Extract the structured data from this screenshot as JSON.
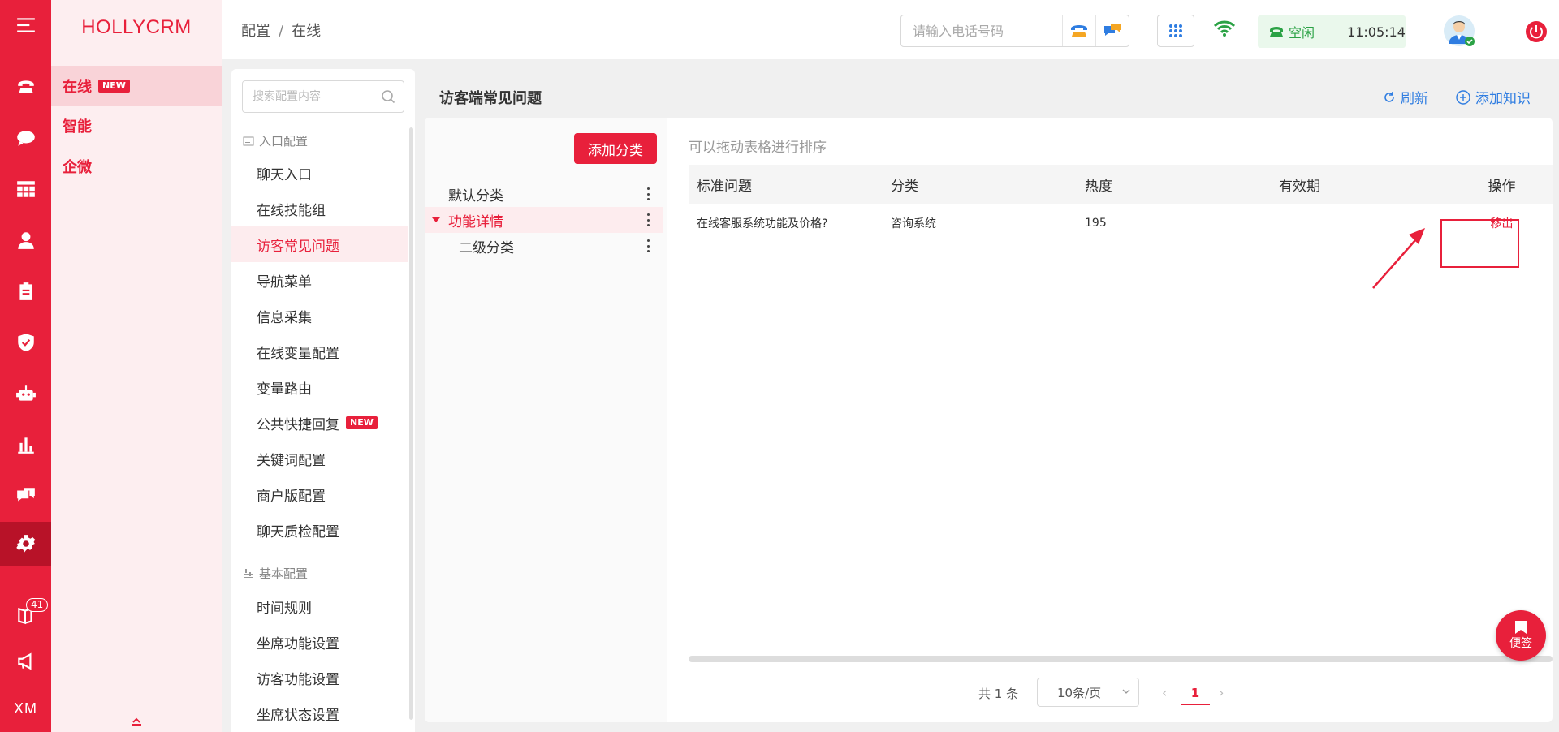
{
  "rail": {
    "badge_count": "41",
    "footer_text": "XM",
    "icons": [
      "menu-icon",
      "phone-icon",
      "chat-icon",
      "grid-icon",
      "user-icon",
      "clipboard-icon",
      "shield-icon",
      "robot-icon",
      "stats-icon",
      "message-icon",
      "settings-icon",
      "book-icon",
      "megaphone-icon"
    ]
  },
  "menu2": {
    "brand": "HOLLYCRM",
    "new_tag": "NEW",
    "items": [
      {
        "label": "在线"
      },
      {
        "label": "智能"
      },
      {
        "label": "企微"
      }
    ]
  },
  "header": {
    "breadcrumb": [
      "配置",
      "在线"
    ],
    "breadcrumb_sep": "/",
    "phone_placeholder": "请输入电话号码",
    "status_label": "空闲",
    "time": "11:05:14"
  },
  "config_nav": {
    "search_placeholder": "搜索配置内容",
    "group1": "入口配置",
    "group1_items": [
      {
        "label": "聊天入口"
      },
      {
        "label": "在线技能组"
      },
      {
        "label": "访客常见问题"
      },
      {
        "label": "导航菜单"
      },
      {
        "label": "信息采集"
      },
      {
        "label": "在线变量配置"
      },
      {
        "label": "变量路由"
      },
      {
        "label": "公共快捷回复",
        "tag": "NEW"
      },
      {
        "label": "关键词配置"
      },
      {
        "label": "商户版配置"
      },
      {
        "label": "聊天质检配置"
      }
    ],
    "group2": "基本配置",
    "group2_items": [
      {
        "label": "时间规则"
      },
      {
        "label": "坐席功能设置"
      },
      {
        "label": "访客功能设置"
      },
      {
        "label": "坐席状态设置"
      }
    ]
  },
  "main": {
    "title": "访客端常见问题",
    "refresh_label": "刷新",
    "add_knowledge_label": "添加知识",
    "add_category_label": "添加分类",
    "categories": [
      {
        "label": "默认分类"
      },
      {
        "label": "功能详情"
      },
      {
        "label": "二级分类"
      }
    ],
    "hint": "可以拖动表格进行排序",
    "columns": [
      "标准问题",
      "分类",
      "热度",
      "有效期",
      "操作"
    ],
    "rows": [
      {
        "question": "在线客服系统功能及价格?",
        "category": "咨询系统",
        "heat": "195",
        "validity": "",
        "action": "移出"
      }
    ],
    "pager": {
      "total": "共 1 条",
      "page_size": "10条/页",
      "prev": "‹",
      "current": "1",
      "next": "›"
    },
    "memo_label": "便签"
  },
  "colors": {
    "brand": "#e8203b",
    "link": "#2f7de1",
    "status_green": "#2ba245"
  }
}
